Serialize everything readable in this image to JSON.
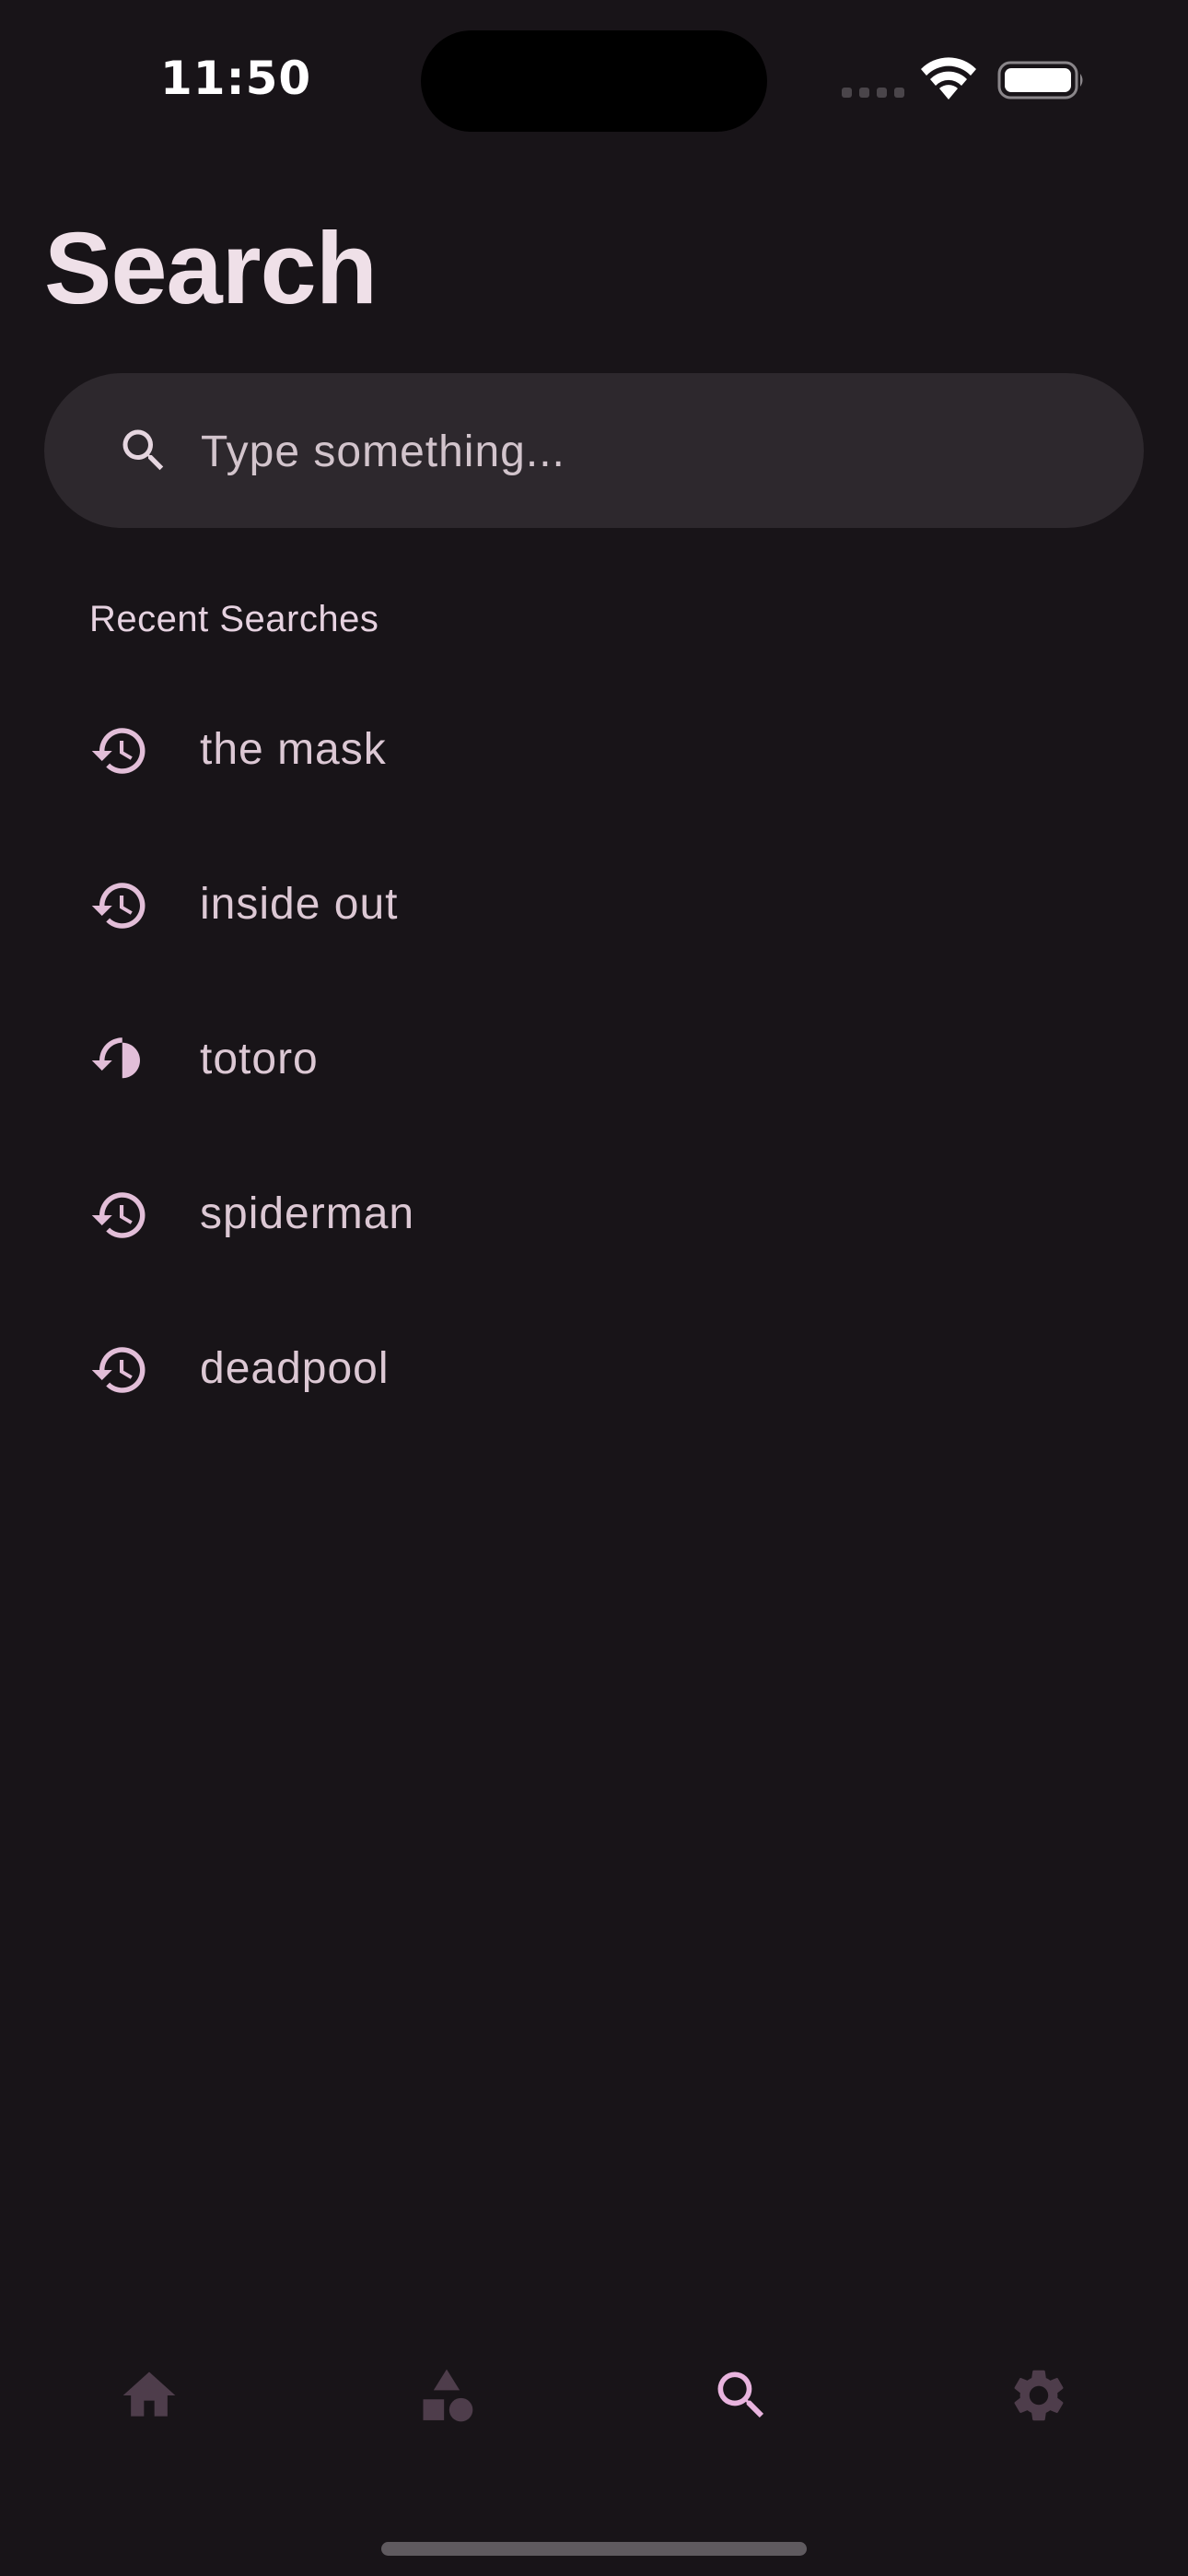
{
  "status_bar": {
    "time": "11:50"
  },
  "page": {
    "title": "Search"
  },
  "search": {
    "placeholder": "Type something...",
    "value": ""
  },
  "recent": {
    "heading": "Recent Searches",
    "items": [
      {
        "label": "the mask",
        "icon": "history-icon"
      },
      {
        "label": "inside out",
        "icon": "history-icon"
      },
      {
        "label": "totoro",
        "icon": "history-icon"
      },
      {
        "label": "spiderman",
        "icon": "history-icon"
      },
      {
        "label": "deadpool",
        "icon": "history-icon"
      }
    ]
  },
  "bottom_nav": {
    "items": [
      {
        "icon": "home-icon",
        "active": false
      },
      {
        "icon": "shapes-icon",
        "active": false
      },
      {
        "icon": "search-icon",
        "active": true
      },
      {
        "icon": "gear-icon",
        "active": false
      }
    ]
  },
  "colors": {
    "background": "#181418",
    "surface": "#2d282d",
    "accent": "#e8b4de",
    "nav_inactive": "#4e3d4b",
    "text_primary": "#efe0e8",
    "text_secondary": "#dcc8d4"
  }
}
